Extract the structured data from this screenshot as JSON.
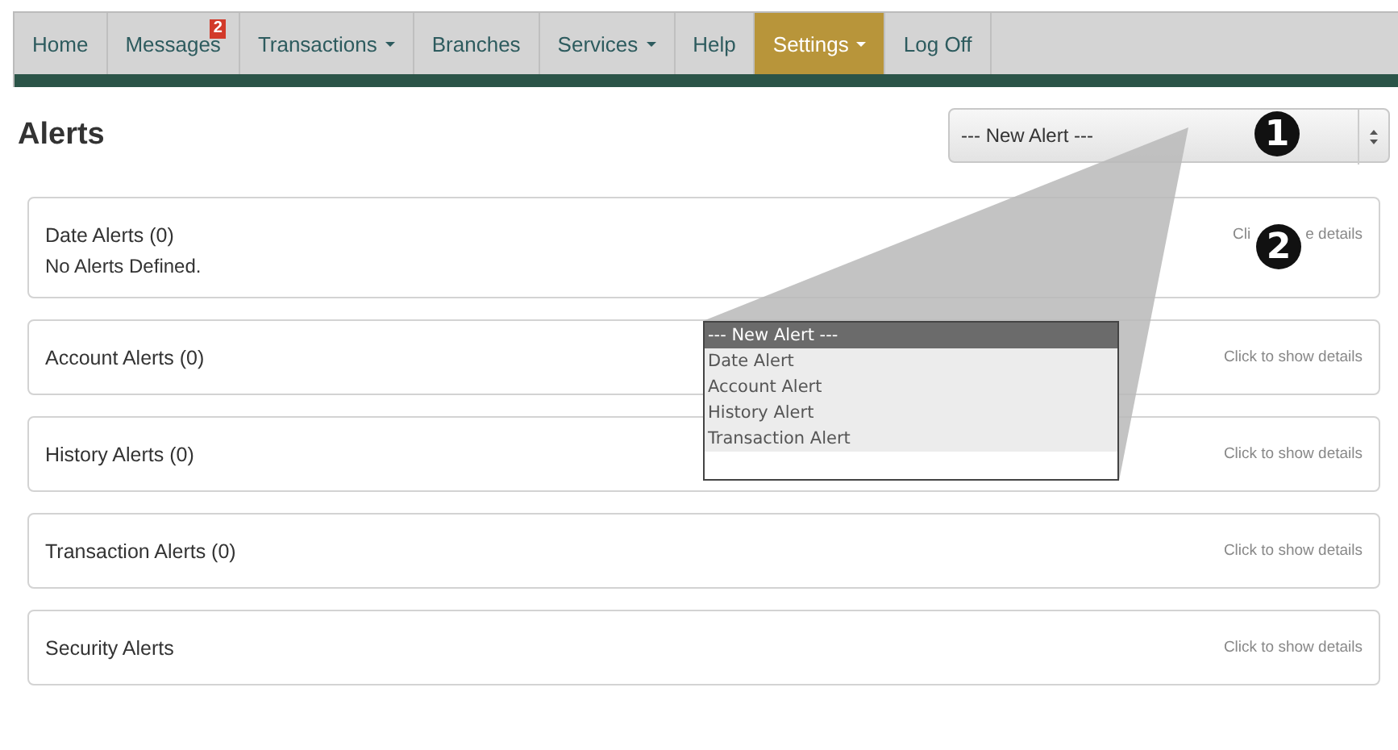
{
  "nav": {
    "items": [
      {
        "label": "Home",
        "selected": false,
        "dropdown": false
      },
      {
        "label": "Messages",
        "selected": false,
        "dropdown": false,
        "badge": "2"
      },
      {
        "label": "Transactions",
        "selected": false,
        "dropdown": true
      },
      {
        "label": "Branches",
        "selected": false,
        "dropdown": false
      },
      {
        "label": "Services",
        "selected": false,
        "dropdown": true
      },
      {
        "label": "Help",
        "selected": false,
        "dropdown": false
      },
      {
        "label": "Settings",
        "selected": true,
        "dropdown": true
      },
      {
        "label": "Log Off",
        "selected": false,
        "dropdown": false
      }
    ]
  },
  "page_title": "Alerts",
  "new_alert_select": {
    "value": "--- New Alert ---"
  },
  "callouts": [
    "1",
    "2"
  ],
  "panels": [
    {
      "title": "Date Alerts (0)",
      "hint_parts": [
        "Cli",
        "e details"
      ],
      "body": "No Alerts Defined."
    },
    {
      "title": "Account Alerts (0)",
      "hint_parts": [
        "Click to show details"
      ]
    },
    {
      "title": "History Alerts (0)",
      "hint_parts": [
        "Click to show details"
      ]
    },
    {
      "title": "Transaction Alerts (0)",
      "hint_parts": [
        "Click to show details"
      ]
    },
    {
      "title": "Security Alerts",
      "hint_parts": [
        "Click to show details"
      ]
    }
  ],
  "dropdown_list": {
    "options": [
      {
        "label": "--- New Alert ---",
        "selected": true
      },
      {
        "label": "Date Alert",
        "selected": false
      },
      {
        "label": "Account Alert",
        "selected": false
      },
      {
        "label": "History Alert",
        "selected": false
      },
      {
        "label": "Transaction Alert",
        "selected": false
      }
    ]
  }
}
